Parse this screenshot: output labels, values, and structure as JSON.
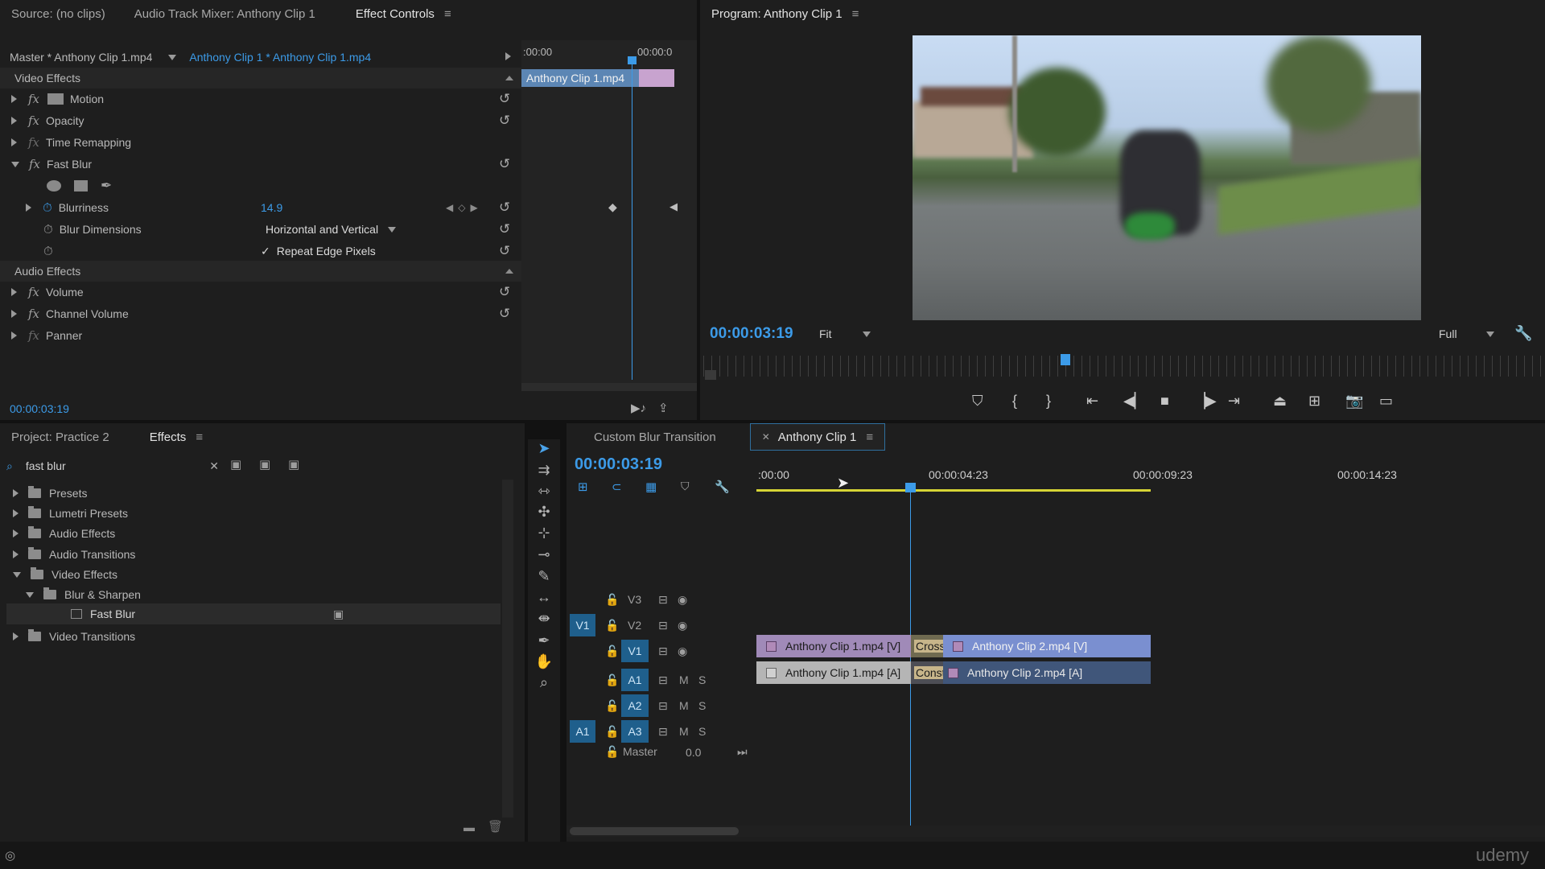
{
  "effect_controls": {
    "tabs": [
      "Source: (no clips)",
      "Audio Track Mixer: Anthony Clip 1",
      "Effect Controls"
    ],
    "master_label": "Master * Anthony Clip 1.mp4",
    "clip_label": "Anthony Clip 1 * Anthony Clip 1.mp4",
    "mini_time_start": ":00:00",
    "mini_time_end": "00:00:0",
    "mini_clip_name": "Anthony Clip 1.mp4",
    "video_effects_label": "Video Effects",
    "effects": [
      "Motion",
      "Opacity",
      "Time Remapping",
      "Fast Blur"
    ],
    "blurriness_label": "Blurriness",
    "blurriness_value": "14.9",
    "blur_dimensions_label": "Blur Dimensions",
    "blur_dimensions_value": "Horizontal and Vertical",
    "repeat_edge_label": "Repeat Edge Pixels",
    "audio_effects_label": "Audio Effects",
    "audio_effects": [
      "Volume",
      "Channel Volume",
      "Panner"
    ],
    "timecode": "00:00:03:19"
  },
  "program": {
    "title": "Program: Anthony Clip 1",
    "timecode": "00:00:03:19",
    "fit_label": "Fit",
    "quality_label": "Full"
  },
  "project": {
    "tabs": [
      "Project: Practice 2",
      "Effects"
    ],
    "search_value": "fast blur",
    "tree": [
      {
        "label": "Presets",
        "expanded": false,
        "indent": 0
      },
      {
        "label": "Lumetri Presets",
        "expanded": false,
        "indent": 0
      },
      {
        "label": "Audio Effects",
        "expanded": false,
        "indent": 0
      },
      {
        "label": "Audio Transitions",
        "expanded": false,
        "indent": 0
      },
      {
        "label": "Video Effects",
        "expanded": true,
        "indent": 0
      },
      {
        "label": "Blur & Sharpen",
        "expanded": true,
        "indent": 1
      },
      {
        "label": "Fast Blur",
        "expanded": false,
        "indent": 2
      },
      {
        "label": "Video Transitions",
        "expanded": false,
        "indent": 0
      }
    ]
  },
  "timeline": {
    "tabs": [
      "Custom Blur Transition",
      "Anthony Clip 1"
    ],
    "timecode": "00:00:03:19",
    "ruler": [
      ":00:00",
      "00:00:04:23",
      "00:00:09:23",
      "00:00:14:23"
    ],
    "video_tracks": [
      "V3",
      "V2",
      "V1"
    ],
    "audio_tracks": [
      "A1",
      "A2",
      "A3"
    ],
    "source_patch_video": "V1",
    "source_patch_audio": "A1",
    "mute_label": "M",
    "solo_label": "S",
    "master_label": "Master",
    "master_value": "0.0",
    "clips": {
      "v1_clip1": "Anthony Clip 1.mp4 [V]",
      "v1_transition": "Cross Di",
      "v1_clip2": "Anthony Clip 2.mp4 [V]",
      "a1_clip1": "Anthony Clip 1.mp4 [A]",
      "a1_transition": "Consta",
      "a1_clip2": "Anthony Clip 2.mp4 [A]"
    }
  },
  "watermark": "udemy",
  "colors": {
    "accent": "#3c9be8",
    "panel": "#1e1e1e",
    "clip_video": "#a08ab8",
    "clip_audio": "#6f88b6"
  }
}
